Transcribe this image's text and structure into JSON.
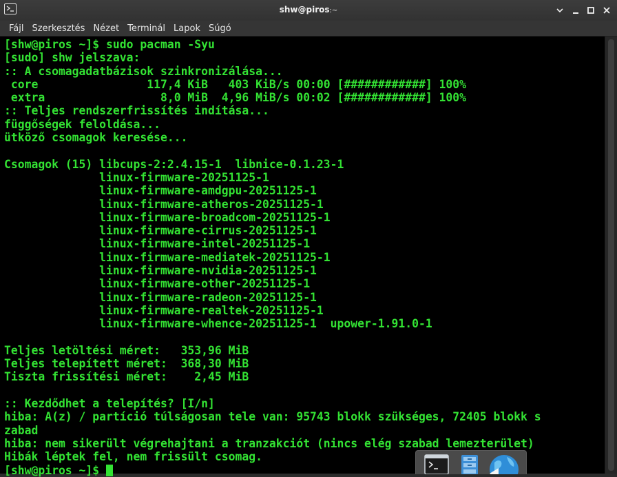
{
  "window": {
    "title": "shw@piros",
    "title_suffix": ":~"
  },
  "menu": [
    "Fájl",
    "Szerkesztés",
    "Nézet",
    "Terminál",
    "Lapok",
    "Súgó"
  ],
  "terminal": {
    "lines": [
      "[shw@piros ~]$ sudo pacman -Syu",
      "[sudo] shw jelszava:",
      ":: A csomagadatbázisok szinkronizálása...",
      " core                117,4 KiB   403 KiB/s 00:00 [############] 100%",
      " extra                 8,0 MiB  4,96 MiB/s 00:02 [############] 100%",
      ":: Teljes rendszerfrissítés indítása...",
      "függőségek feloldása...",
      "ütköző csomagok keresése...",
      "",
      "Csomagok (15) libcups-2:2.4.15-1  libnice-0.1.23-1",
      "              linux-firmware-20251125-1",
      "              linux-firmware-amdgpu-20251125-1",
      "              linux-firmware-atheros-20251125-1",
      "              linux-firmware-broadcom-20251125-1",
      "              linux-firmware-cirrus-20251125-1",
      "              linux-firmware-intel-20251125-1",
      "              linux-firmware-mediatek-20251125-1",
      "              linux-firmware-nvidia-20251125-1",
      "              linux-firmware-other-20251125-1",
      "              linux-firmware-radeon-20251125-1",
      "              linux-firmware-realtek-20251125-1",
      "              linux-firmware-whence-20251125-1  upower-1.91.0-1",
      "",
      "Teljes letöltési méret:   353,96 MiB",
      "Teljes telepített méret:  368,30 MiB",
      "Tiszta frissítési méret:    2,45 MiB",
      "",
      ":: Kezdődhet a telepítés? [I/n]",
      "hiba: A(z) / partíció túlságosan tele van: 95743 blokk szükséges, 72405 blokk s",
      "zabad",
      "hiba: nem sikerült végrehajtani a tranzakciót (nincs elég szabad lemezterület)",
      "Hibák léptek fel, nem frissült csomag."
    ],
    "prompt": "[shw@piros ~]$ "
  },
  "dock": {
    "items": [
      "terminal-icon",
      "file-manager-icon",
      "browser-globe-icon"
    ]
  },
  "colors": {
    "terminal_fg": "#33e233",
    "terminal_bg": "#000000",
    "titlebar_bg": "#3a3a3a"
  }
}
